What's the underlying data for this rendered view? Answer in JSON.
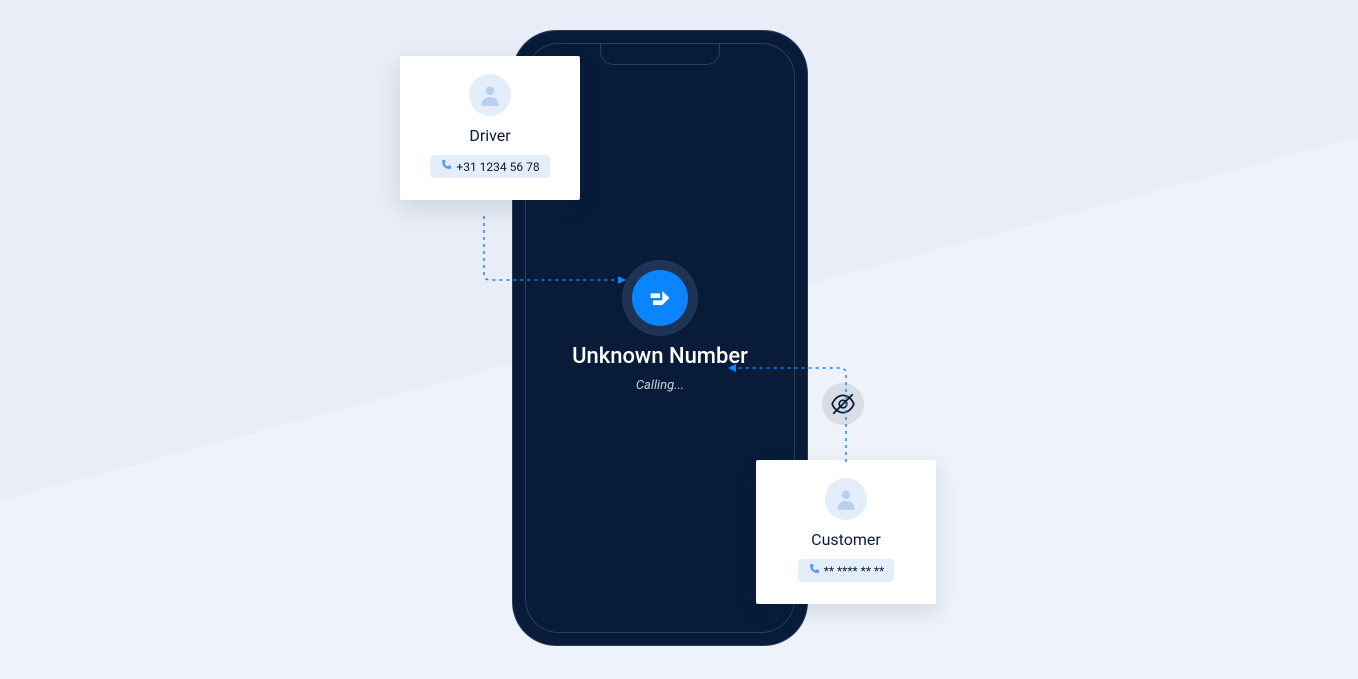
{
  "phone": {
    "caller_label": "Unknown Number",
    "status_text": "Calling..."
  },
  "driver_card": {
    "title": "Driver",
    "phone_number": "+31 1234 56 78"
  },
  "customer_card": {
    "title": "Customer",
    "phone_number": "** **** ** **"
  },
  "colors": {
    "accent": "#0a84ff",
    "phone_bg": "#081c3a",
    "page_bg": "#e8edf7"
  }
}
